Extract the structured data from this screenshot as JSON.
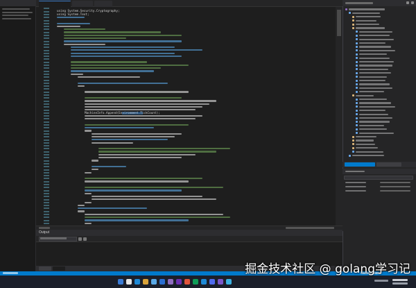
{
  "code": {
    "lines": [
      {
        "text": "",
        "color": "#569cd6",
        "indent": 0
      },
      {
        "text": "using System.Security.Cryptography;",
        "color": "#d4d4d4",
        "indent": 0
      },
      {
        "text": "using System.Text;",
        "color": "#d4d4d4",
        "indent": 0
      },
      {
        "text": "",
        "color": "#569cd6",
        "indent": 0
      },
      {
        "text": "",
        "color": "#d4d4d4",
        "indent": 0
      },
      {
        "text": "",
        "color": "#569cd6",
        "indent": 0
      },
      {
        "text": "",
        "color": "#d4d4d4",
        "indent": 0
      },
      {
        "text": "",
        "color": "#6a9955",
        "indent": 1
      },
      {
        "text": "",
        "color": "#6a9955",
        "indent": 1
      },
      {
        "text": "",
        "color": "#6a9955",
        "indent": 1
      },
      {
        "text": "",
        "color": "#6a9955",
        "indent": 1
      },
      {
        "text": "",
        "color": "#569cd6",
        "indent": 1
      },
      {
        "text": "",
        "color": "#d4d4d4",
        "indent": 1
      },
      {
        "text": "",
        "color": "#569cd6",
        "indent": 2
      },
      {
        "text": "",
        "color": "#569cd6",
        "indent": 2
      },
      {
        "text": "",
        "color": "#569cd6",
        "indent": 2
      },
      {
        "text": "",
        "color": "#569cd6",
        "indent": 2
      },
      {
        "text": "",
        "color": "#d4d4d4",
        "indent": 0
      },
      {
        "text": "",
        "color": "#6a9955",
        "indent": 2
      },
      {
        "text": "",
        "color": "#6a9955",
        "indent": 2
      },
      {
        "text": "",
        "color": "#6a9955",
        "indent": 2
      },
      {
        "text": "",
        "color": "#569cd6",
        "indent": 2
      },
      {
        "text": "",
        "color": "#d4d4d4",
        "indent": 2
      },
      {
        "text": "",
        "color": "#d4d4d4",
        "indent": 3
      },
      {
        "text": "",
        "color": "#d4d4d4",
        "indent": 0
      },
      {
        "text": "",
        "color": "#569cd6",
        "indent": 3
      },
      {
        "text": "",
        "color": "#d4d4d4",
        "indent": 3
      },
      {
        "text": "",
        "color": "#d4d4d4",
        "indent": 0
      },
      {
        "text": "",
        "color": "#d4d4d4",
        "indent": 4
      },
      {
        "text": "",
        "color": "#d4d4d4",
        "indent": 0
      },
      {
        "text": "",
        "color": "#6a9955",
        "indent": 4
      },
      {
        "text": "",
        "color": "#d4d4d4",
        "indent": 4
      },
      {
        "text": "",
        "color": "#d4d4d4",
        "indent": 4
      },
      {
        "text": "",
        "color": "#d4d4d4",
        "indent": 4
      },
      {
        "text": "",
        "color": "#d4d4d4",
        "indent": 4
      },
      {
        "text": "MachineInfo.Append(Environment.TickCount);",
        "color": "#d4d4d4",
        "indent": 4
      },
      {
        "text": "",
        "color": "#d4d4d4",
        "indent": 4
      },
      {
        "text": "",
        "color": "#d4d4d4",
        "indent": 4
      },
      {
        "text": "",
        "color": "#d4d4d4",
        "indent": 0
      },
      {
        "text": "",
        "color": "#6a9955",
        "indent": 4
      },
      {
        "text": "",
        "color": "#569cd6",
        "indent": 4
      },
      {
        "text": "",
        "color": "#d4d4d4",
        "indent": 4
      },
      {
        "text": "",
        "color": "#d4d4d4",
        "indent": 5
      },
      {
        "text": "",
        "color": "#d4d4d4",
        "indent": 5
      },
      {
        "text": "",
        "color": "#569cd6",
        "indent": 5
      },
      {
        "text": "",
        "color": "#d4d4d4",
        "indent": 5
      },
      {
        "text": "",
        "color": "#d4d4d4",
        "indent": 0
      },
      {
        "text": "",
        "color": "#6a9955",
        "indent": 6
      },
      {
        "text": "",
        "color": "#6a9955",
        "indent": 6
      },
      {
        "text": "",
        "color": "#d4d4d4",
        "indent": 6
      },
      {
        "text": "",
        "color": "#d4d4d4",
        "indent": 6
      },
      {
        "text": "",
        "color": "#d4d4d4",
        "indent": 5
      },
      {
        "text": "",
        "color": "#d4d4d4",
        "indent": 0
      },
      {
        "text": "",
        "color": "#569cd6",
        "indent": 5
      },
      {
        "text": "",
        "color": "#d4d4d4",
        "indent": 5
      },
      {
        "text": "",
        "color": "#d4d4d4",
        "indent": 4
      },
      {
        "text": "",
        "color": "#d4d4d4",
        "indent": 0
      },
      {
        "text": "",
        "color": "#6a9955",
        "indent": 4
      },
      {
        "text": "",
        "color": "#d4d4d4",
        "indent": 4
      },
      {
        "text": "",
        "color": "#d4d4d4",
        "indent": 0
      },
      {
        "text": "",
        "color": "#6a9955",
        "indent": 4
      },
      {
        "text": "",
        "color": "#569cd6",
        "indent": 4
      },
      {
        "text": "",
        "color": "#d4d4d4",
        "indent": 4
      },
      {
        "text": "",
        "color": "#d4d4d4",
        "indent": 5
      },
      {
        "text": "",
        "color": "#d4d4d4",
        "indent": 5
      },
      {
        "text": "",
        "color": "#d4d4d4",
        "indent": 4
      },
      {
        "text": "",
        "color": "#d4d4d4",
        "indent": 3
      },
      {
        "text": "",
        "color": "#569cd6",
        "indent": 3
      },
      {
        "text": "",
        "color": "#d4d4d4",
        "indent": 3
      },
      {
        "text": "",
        "color": "#d4d4d4",
        "indent": 4
      },
      {
        "text": "",
        "color": "#6a9955",
        "indent": 4
      },
      {
        "text": "",
        "color": "#569cd6",
        "indent": 4
      },
      {
        "text": "",
        "color": "#d4d4d4",
        "indent": 4
      },
      {
        "text": "",
        "color": "#d4d4d4",
        "indent": 0
      },
      {
        "text": "",
        "color": "#d4d4d4",
        "indent": 4
      }
    ]
  },
  "solution_explorer": {
    "title": "",
    "items": [
      {
        "label": "",
        "indent": 0,
        "icon_color": "#8f6dbf"
      },
      {
        "label": "",
        "indent": 1,
        "icon_color": "#6aaaee"
      },
      {
        "label": "",
        "indent": 2,
        "icon_color": "#dcb67a"
      },
      {
        "label": "",
        "indent": 2,
        "icon_color": "#dcb67a"
      },
      {
        "label": "",
        "indent": 2,
        "icon_color": "#dcb67a"
      },
      {
        "label": "",
        "indent": 2,
        "icon_color": "#dcb67a"
      },
      {
        "label": "",
        "indent": 3,
        "icon_color": "#6aaaee"
      },
      {
        "label": "",
        "indent": 3,
        "icon_color": "#6aaaee"
      },
      {
        "label": "",
        "indent": 3,
        "icon_color": "#6aaaee"
      },
      {
        "label": "",
        "indent": 3,
        "icon_color": "#6aaaee"
      },
      {
        "label": "",
        "indent": 3,
        "icon_color": "#6aaaee"
      },
      {
        "label": "",
        "indent": 3,
        "icon_color": "#6aaaee"
      },
      {
        "label": "",
        "indent": 3,
        "icon_color": "#6aaaee"
      },
      {
        "label": "",
        "indent": 3,
        "icon_color": "#6aaaee"
      },
      {
        "label": "",
        "indent": 3,
        "icon_color": "#6aaaee"
      },
      {
        "label": "",
        "indent": 3,
        "icon_color": "#6aaaee"
      },
      {
        "label": "",
        "indent": 3,
        "icon_color": "#6aaaee"
      },
      {
        "label": "",
        "indent": 3,
        "icon_color": "#6aaaee"
      },
      {
        "label": "",
        "indent": 3,
        "icon_color": "#6aaaee"
      },
      {
        "label": "",
        "indent": 3,
        "icon_color": "#6aaaee"
      },
      {
        "label": "",
        "indent": 3,
        "icon_color": "#6aaaee"
      },
      {
        "label": "",
        "indent": 3,
        "icon_color": "#6aaaee"
      },
      {
        "label": "",
        "indent": 3,
        "icon_color": "#6aaaee"
      },
      {
        "label": "",
        "indent": 2,
        "icon_color": "#dcb67a"
      },
      {
        "label": "",
        "indent": 3,
        "icon_color": "#6aaaee"
      },
      {
        "label": "",
        "indent": 3,
        "icon_color": "#6aaaee"
      },
      {
        "label": "",
        "indent": 3,
        "icon_color": "#6aaaee"
      },
      {
        "label": "",
        "indent": 3,
        "icon_color": "#6aaaee"
      },
      {
        "label": "",
        "indent": 3,
        "icon_color": "#6aaaee"
      },
      {
        "label": "",
        "indent": 3,
        "icon_color": "#6aaaee"
      },
      {
        "label": "",
        "indent": 3,
        "icon_color": "#6aaaee"
      },
      {
        "label": "",
        "indent": 3,
        "icon_color": "#6aaaee"
      },
      {
        "label": "",
        "indent": 3,
        "icon_color": "#6aaaee"
      },
      {
        "label": "",
        "indent": 3,
        "icon_color": "#6aaaee"
      },
      {
        "label": "",
        "indent": 2,
        "icon_color": "#dcb67a"
      },
      {
        "label": "",
        "indent": 2,
        "icon_color": "#dcb67a"
      },
      {
        "label": "",
        "indent": 2,
        "icon_color": "#dcb67a"
      },
      {
        "label": "",
        "indent": 2,
        "icon_color": "#dcb67a"
      },
      {
        "label": "",
        "indent": 2,
        "icon_color": "#6aaaee"
      },
      {
        "label": "",
        "indent": 1,
        "icon_color": "#6aaaee"
      }
    ]
  },
  "right_tabs": [
    "",
    ""
  ],
  "properties": {
    "title": "",
    "rows": [
      {
        "name": "",
        "value": ""
      },
      {
        "name": "",
        "value": ""
      },
      {
        "name": "",
        "value": ""
      }
    ]
  },
  "output": {
    "title": "Output",
    "show_from": ""
  },
  "bottom_tabs": [
    "",
    ""
  ],
  "watermark": "掘金技术社区 @ golang学习记",
  "colors": {
    "accent": "#007acc",
    "editor_bg": "#1e1e1e",
    "panel_bg": "#252526",
    "keyword": "#569cd6",
    "comment": "#6a9955",
    "type": "#4ec9b0"
  }
}
